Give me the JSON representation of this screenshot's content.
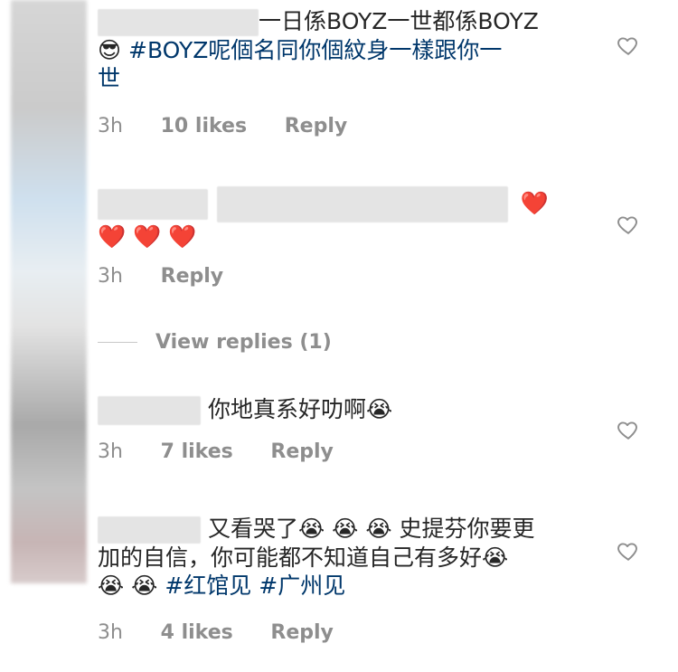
{
  "comments": [
    {
      "text_a": "一日係BOYZ一世都係BOYZ",
      "emoji_a": "😎",
      "hashtag": "#BOYZ",
      "text_b": "呢個名同你個紋身一樣跟你一",
      "text_c": "世",
      "time": "3h",
      "likes": "10 likes",
      "reply": "Reply"
    },
    {
      "hearts": [
        "❤️",
        "❤️",
        "❤️",
        "❤️"
      ],
      "time": "3h",
      "reply": "Reply"
    },
    {
      "text_a": "你地真系好叻啊",
      "emoji_a": "😭",
      "time": "3h",
      "likes": "7 likes",
      "reply": "Reply"
    },
    {
      "text_a": "又看哭了",
      "emojis_a": [
        "😭",
        "😭",
        "😭"
      ],
      "text_b": "史提芬你要更",
      "text_c": "加的自信，你可能都不知道自己有多好",
      "emoji_c": "😭",
      "emojis_d": [
        "😭",
        "😭"
      ],
      "hashtag_1": "#红馆见",
      "hashtag_2": "#广州见",
      "time": "3h",
      "likes": "4 likes",
      "reply": "Reply"
    }
  ],
  "view_replies": "View replies (1)",
  "icons": {
    "like": "heart-outline-icon"
  }
}
